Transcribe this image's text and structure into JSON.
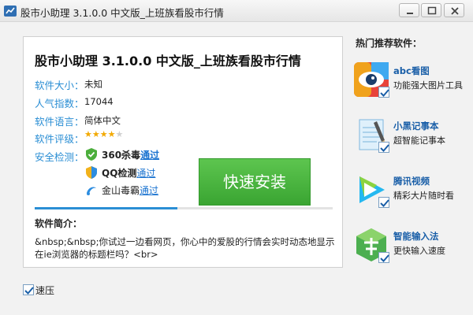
{
  "window": {
    "title": "股市小助理 3.1.0.0 中文版_上班族看股市行情"
  },
  "app": {
    "name": "股市小助理 3.1.0.0 中文版_上班族看股市行情",
    "info": [
      {
        "label": "软件大小：",
        "value": "未知"
      },
      {
        "label": "人气指数：",
        "value": "17044"
      },
      {
        "label": "软件语言：",
        "value": "简体中文"
      },
      {
        "label": "软件评级：",
        "value": ""
      }
    ],
    "rating": 4,
    "rating_max": 5,
    "security_label": "安全检测：",
    "security": [
      {
        "name": "360杀毒",
        "status": "通过"
      },
      {
        "name": "QQ检测",
        "status": "通过"
      },
      {
        "name": "金山毒霸",
        "status": "通过"
      }
    ],
    "install_label": "快速安装",
    "progress": 0.48,
    "intro_title": "软件简介：",
    "intro_text": "&nbsp;&nbsp;你试过一边看网页，你心中的爱股的行情会实时动态地显示在ie浏览器的标题栏吗？<br>"
  },
  "recommend": {
    "title": "热门推荐软件：",
    "items": [
      {
        "name": "abc看图",
        "desc": "功能强大图片工具",
        "icon": "eye-icon",
        "checked": true
      },
      {
        "name": "小黑记事本",
        "desc": "超智能记事本",
        "icon": "notepad-icon",
        "checked": true
      },
      {
        "name": "腾讯视频",
        "desc": "精彩大片随时看",
        "icon": "video-play-icon",
        "checked": true
      },
      {
        "name": "智能输入法",
        "desc": "更快输入速度",
        "icon": "pinyin-icon",
        "checked": true
      }
    ]
  },
  "speed": {
    "label": "速压",
    "checked": true
  },
  "colors": {
    "accent_blue": "#2a8ed4",
    "install_green": "#3aa532",
    "link_blue": "#1a73d0"
  }
}
